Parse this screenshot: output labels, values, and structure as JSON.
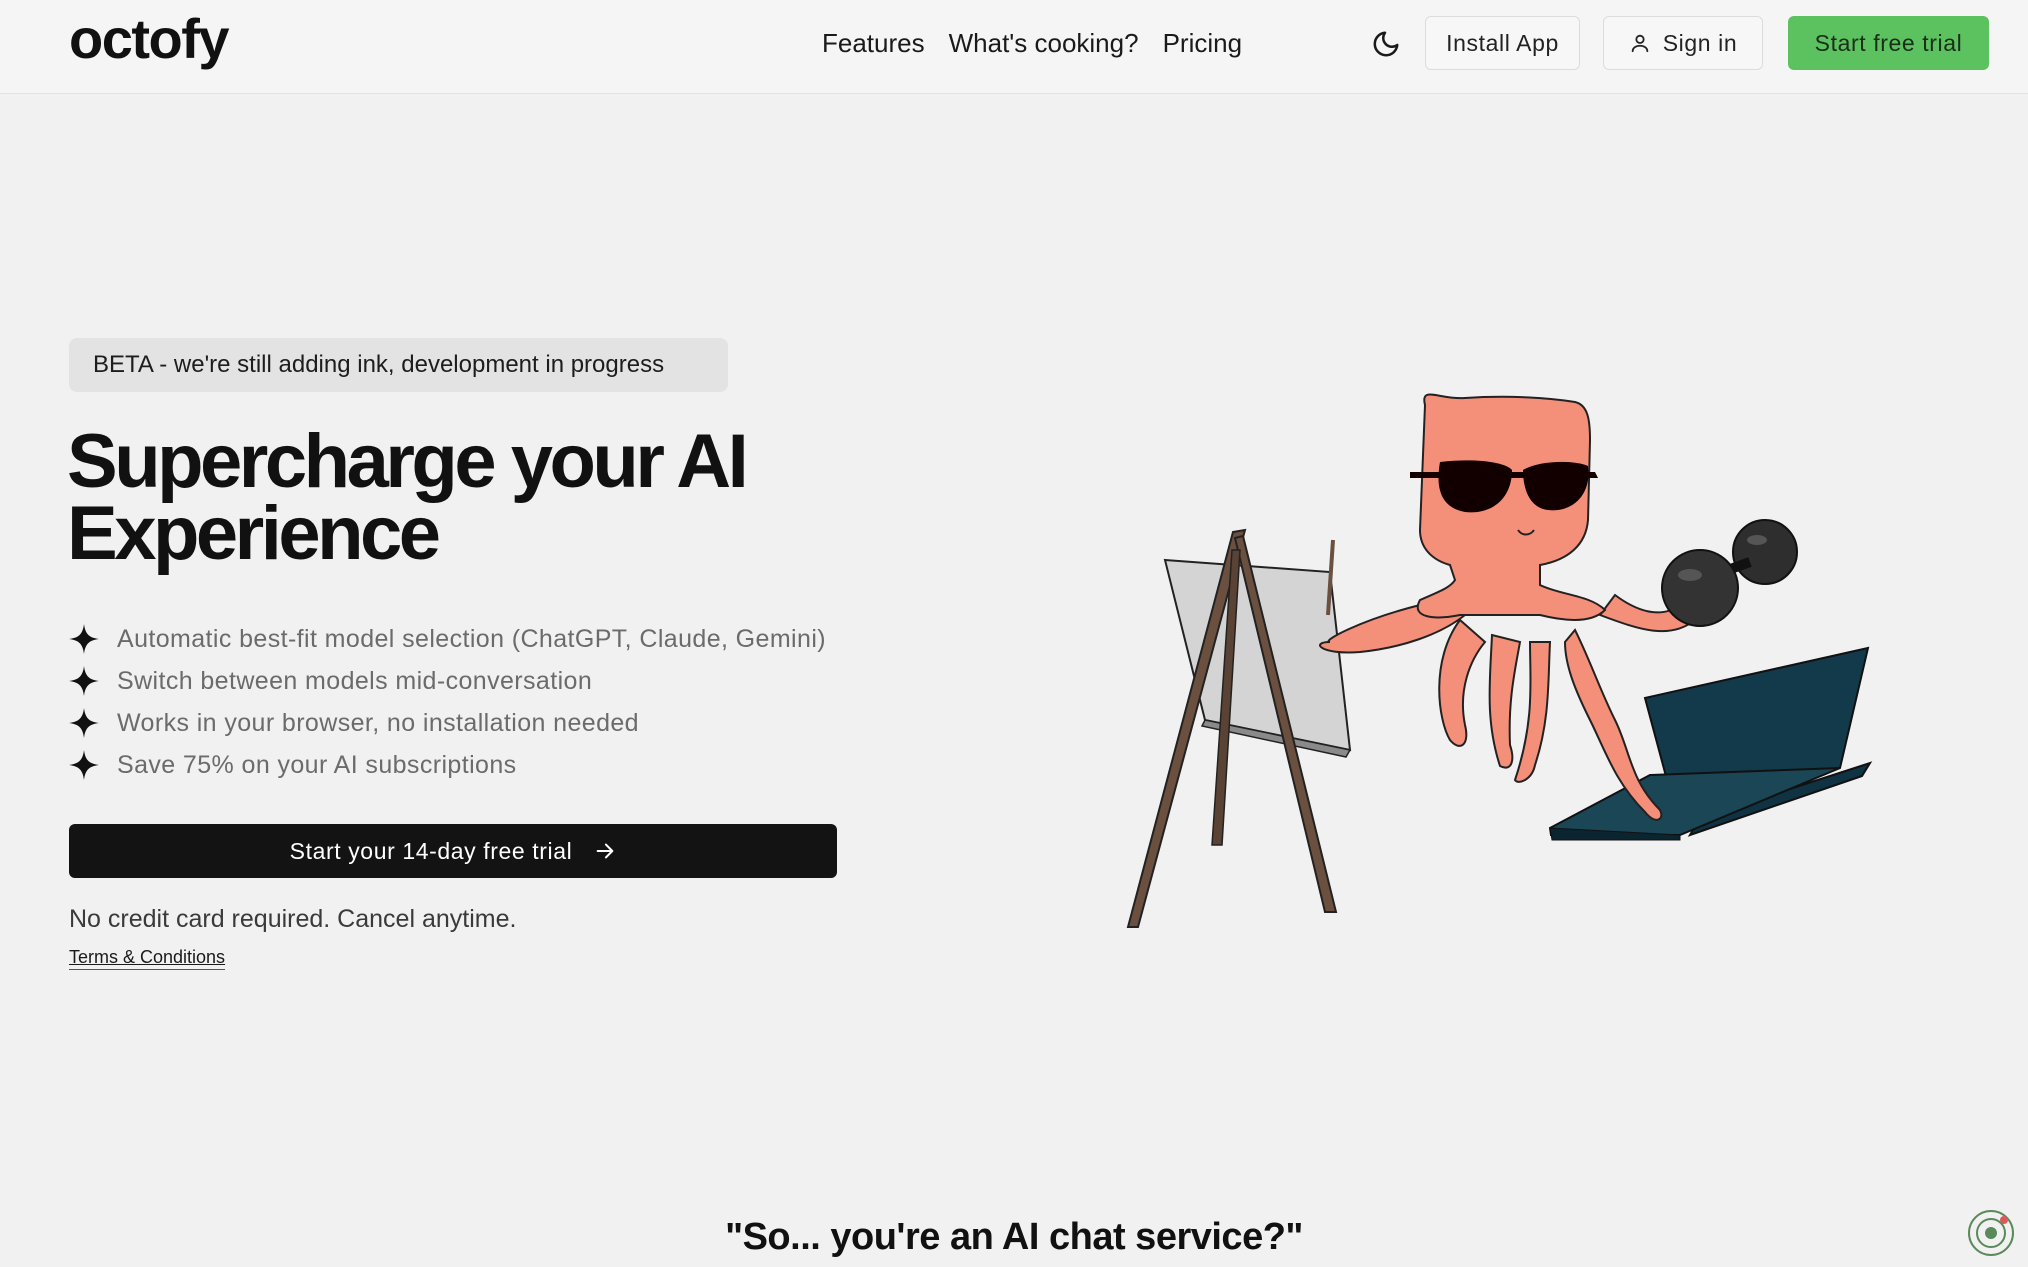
{
  "header": {
    "logo": "octofy",
    "nav": [
      "Features",
      "What's cooking?",
      "Pricing"
    ],
    "theme_icon": "moon-icon",
    "install_label": "Install App",
    "signin_label": "Sign in",
    "signin_icon": "user-icon",
    "trial_label": "Start free trial"
  },
  "hero": {
    "beta_badge": "BETA - we're still adding ink, development in progress",
    "headline_line1": "Supercharge your AI",
    "headline_line2": "Experience",
    "features": [
      "Automatic best-fit model selection (ChatGPT, Claude, Gemini)",
      "Switch between models mid-conversation",
      "Works in your browser, no installation needed",
      "Save 75% on your AI subscriptions"
    ],
    "feature_icon": "sparkle-icon",
    "cta_label": "Start your 14-day free trial",
    "cta_icon": "arrow-right-icon",
    "no_card": "No credit card required. Cancel anytime.",
    "terms": "Terms & Conditions"
  },
  "section": {
    "title": "\"So... you're an AI chat service?\""
  },
  "colors": {
    "accent_green": "#5cc15f",
    "cta_dark": "#131313",
    "octopus": "#f4907a"
  }
}
